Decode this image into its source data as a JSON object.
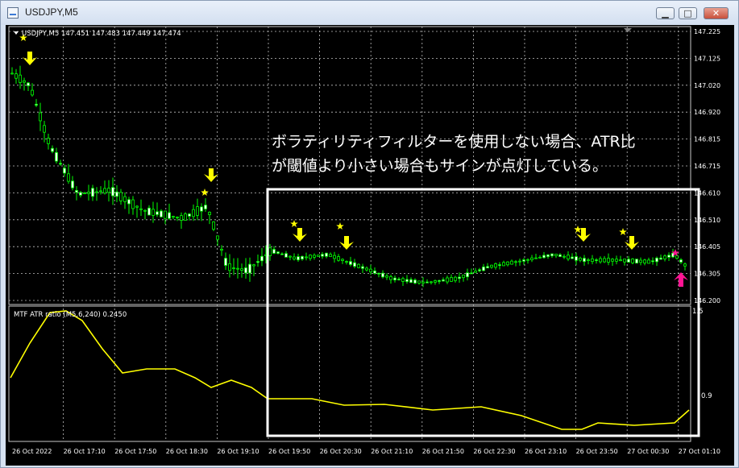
{
  "window": {
    "title": "USDJPY,M5",
    "buttons": {
      "minimize": "▁",
      "maximize": "□",
      "close": "✕"
    }
  },
  "chart": {
    "header": "USDJPY,M5  147.451 147.483 147.449 147.474",
    "price_labels": [
      "147.225",
      "147.125",
      "147.020",
      "146.920",
      "146.815",
      "146.715",
      "146.610",
      "146.510",
      "146.405",
      "146.305",
      "146.200"
    ],
    "time_labels": [
      "26 Oct 2022",
      "26 Oct 17:10",
      "26 Oct 17:50",
      "26 Oct 18:30",
      "26 Oct 19:10",
      "26 Oct 19:50",
      "26 Oct 20:30",
      "26 Oct 21:10",
      "26 Oct 21:50",
      "26 Oct 22:30",
      "26 Oct 23:10",
      "26 Oct 23:50",
      "27 Oct 00:30",
      "27 Oct 01:10"
    ]
  },
  "indicator": {
    "label": "MTF ATR ratio (M5,6,240) 0.2450",
    "scale_top": "1.5",
    "scale_mid": "0.9"
  },
  "annotation": {
    "line1": "ボラティリティフィルターを使用しない場合、ATR比",
    "line2": "が閾値より小さい場合もサインが点灯している。"
  },
  "colors": {
    "background": "#000000",
    "candle": "#00ff00",
    "grid": "#c8c8c8",
    "indicator_line": "#ffff00",
    "sell_arrow": "#ffff00",
    "buy_arrow": "#ff1493",
    "highlight_box": "#ffffff"
  }
}
